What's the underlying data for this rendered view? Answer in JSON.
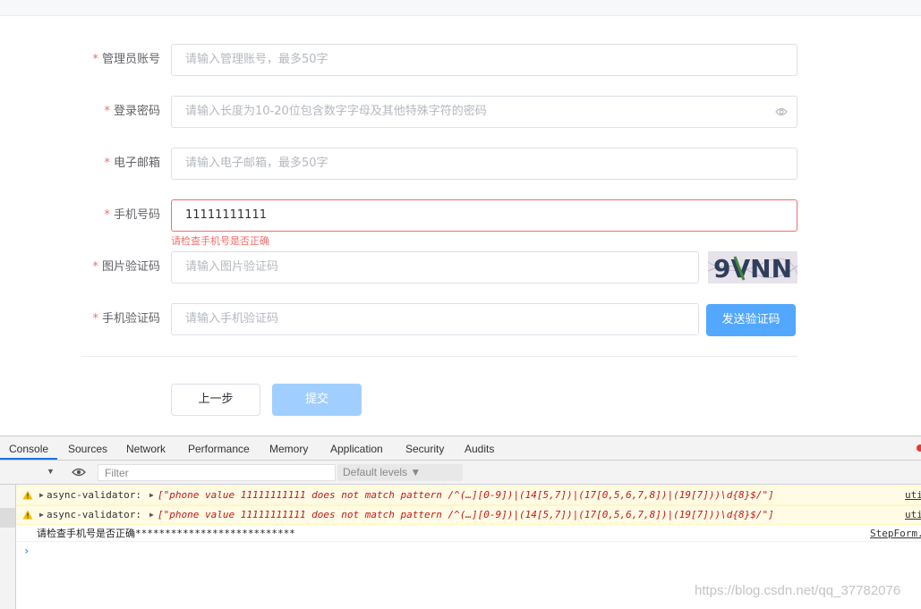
{
  "form": {
    "fields": [
      {
        "label": "管理员账号",
        "required": "*",
        "placeholder": "请输入管理账号，最多50字",
        "value": ""
      },
      {
        "label": "登录密码",
        "required": "*",
        "placeholder": "请输入长度为10-20位包含数字字母及其他特殊字符的密码",
        "value": ""
      },
      {
        "label": "电子邮箱",
        "required": "*",
        "placeholder": "请输入电子邮箱，最多50字",
        "value": ""
      },
      {
        "label": "手机号码",
        "required": "*",
        "placeholder": "",
        "value": "11111111111",
        "error": "请检查手机号是否正确"
      },
      {
        "label": "图片验证码",
        "required": "*",
        "placeholder": "请输入图片验证码",
        "value": ""
      },
      {
        "label": "手机验证码",
        "required": "*",
        "placeholder": "请输入手机验证码",
        "value": ""
      }
    ],
    "captcha_text": "9VNN",
    "send_code_label": "发送验证码",
    "prev_label": "上一步",
    "submit_label": "提交"
  },
  "devtools": {
    "tabs": [
      "Console",
      "Sources",
      "Network",
      "Performance",
      "Memory",
      "Application",
      "Security",
      "Audits"
    ],
    "active_tab": "Console",
    "filter_placeholder": "Filter",
    "levels_label": "Default levels ▼",
    "messages": [
      {
        "level": "warning",
        "prefix": "async-validator:",
        "text": "[\"phone value 11111111111 does not match pattern /^(…][0-9])|(14[5,7])|(17[0,5,6,7,8])|(19[7]))\\d{8}$/\"]",
        "source": "uti"
      },
      {
        "level": "warning",
        "prefix": "async-validator:",
        "text": "[\"phone value 11111111111 does not match pattern /^(…][0-9])|(14[5,7])|(17[0,5,6,7,8])|(19[7]))\\d{8}$/\"]",
        "source": "uti"
      },
      {
        "level": "log",
        "text": "请检查手机号是否正确***************************",
        "source": "StepForm."
      }
    ],
    "prompt": "›"
  },
  "watermark": "https://blog.csdn.net/qq_37782076",
  "colors": {
    "primary": "#409eff",
    "error": "#f56c6c",
    "warning_bg": "#fffbe5"
  }
}
